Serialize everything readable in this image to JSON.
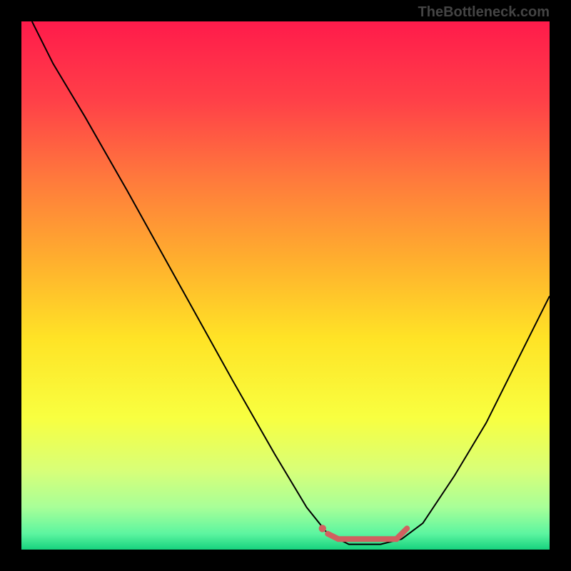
{
  "watermark": "TheBottleneck.com",
  "chart_data": {
    "type": "line",
    "title": "",
    "xlabel": "",
    "ylabel": "",
    "xlim": [
      0,
      100
    ],
    "ylim": [
      0,
      100
    ],
    "background": {
      "type": "vertical-gradient",
      "stops": [
        {
          "offset": 0.0,
          "color": "#ff1b4b"
        },
        {
          "offset": 0.15,
          "color": "#ff4048"
        },
        {
          "offset": 0.3,
          "color": "#ff7a3c"
        },
        {
          "offset": 0.45,
          "color": "#ffae2e"
        },
        {
          "offset": 0.6,
          "color": "#ffe326"
        },
        {
          "offset": 0.75,
          "color": "#f8ff40"
        },
        {
          "offset": 0.85,
          "color": "#d8ff78"
        },
        {
          "offset": 0.92,
          "color": "#a8ff98"
        },
        {
          "offset": 0.97,
          "color": "#5cf5a0"
        },
        {
          "offset": 1.0,
          "color": "#17d27e"
        }
      ]
    },
    "series": [
      {
        "name": "bottleneck-curve",
        "color": "#000000",
        "width": 2,
        "points": [
          {
            "x": 2,
            "y": 100
          },
          {
            "x": 6,
            "y": 92
          },
          {
            "x": 12,
            "y": 82
          },
          {
            "x": 20,
            "y": 68
          },
          {
            "x": 30,
            "y": 50
          },
          {
            "x": 40,
            "y": 32
          },
          {
            "x": 48,
            "y": 18
          },
          {
            "x": 54,
            "y": 8
          },
          {
            "x": 58,
            "y": 3
          },
          {
            "x": 62,
            "y": 1
          },
          {
            "x": 68,
            "y": 1
          },
          {
            "x": 72,
            "y": 2
          },
          {
            "x": 76,
            "y": 5
          },
          {
            "x": 82,
            "y": 14
          },
          {
            "x": 88,
            "y": 24
          },
          {
            "x": 94,
            "y": 36
          },
          {
            "x": 100,
            "y": 48
          }
        ]
      },
      {
        "name": "optimal-range-marker",
        "color": "#d16060",
        "width": 8,
        "points": [
          {
            "x": 58,
            "y": 3
          },
          {
            "x": 60,
            "y": 2
          },
          {
            "x": 64,
            "y": 2
          },
          {
            "x": 68,
            "y": 2
          },
          {
            "x": 71,
            "y": 2
          },
          {
            "x": 73,
            "y": 4
          }
        ],
        "dot": {
          "x": 57,
          "y": 4,
          "r": 4
        }
      }
    ]
  }
}
